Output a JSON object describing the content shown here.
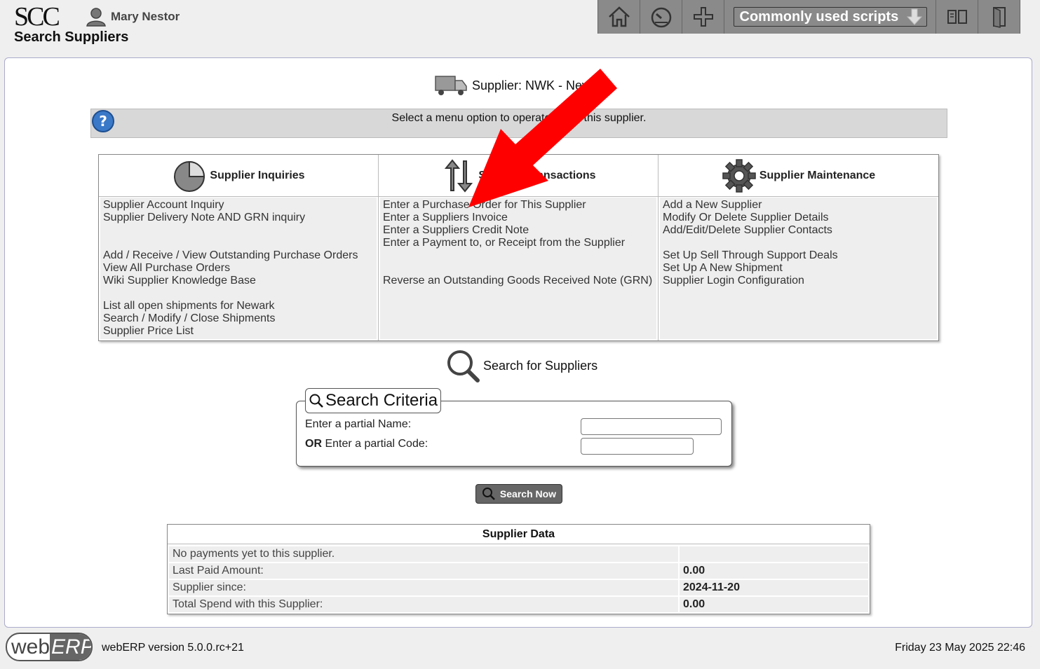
{
  "header": {
    "logo_text": "SCC",
    "user_name": "Mary Nestor",
    "page_title": "Search Suppliers",
    "toolbar": {
      "home_icon": "home-icon",
      "dashboard_icon": "dashboard-icon",
      "add_icon": "plus-icon",
      "scripts_label": "Commonly used scripts",
      "manual_icon": "book-icon",
      "logout_icon": "logout-icon"
    }
  },
  "supplier": {
    "label": "Supplier: NWK - Newark"
  },
  "help": {
    "text": "Select a menu option to operate using this supplier."
  },
  "menu": {
    "inquiries": {
      "title": "Supplier Inquiries",
      "items": [
        "Supplier Account Inquiry",
        "Supplier Delivery Note AND GRN inquiry",
        "Add / Receive / View Outstanding Purchase Orders",
        "View All Purchase Orders",
        "Wiki Supplier Knowledge Base",
        "List all open shipments for Newark",
        "Search / Modify / Close Shipments",
        "Supplier Price List"
      ]
    },
    "transactions": {
      "title": "Supplier Transactions",
      "items": [
        "Enter a Purchase Order for This Supplier",
        "Enter a Suppliers Invoice",
        "Enter a Suppliers Credit Note",
        "Enter a Payment to, or Receipt from the Supplier",
        "Reverse an Outstanding Goods Received Note (GRN)"
      ]
    },
    "maintenance": {
      "title": "Supplier Maintenance",
      "items": [
        "Add a New Supplier",
        "Modify Or Delete Supplier Details",
        "Add/Edit/Delete Supplier Contacts",
        "Set Up Sell Through Support Deals",
        "Set Up A New Shipment",
        "Supplier Login Configuration"
      ]
    }
  },
  "search": {
    "heading": "Search for Suppliers",
    "legend": "Search Criteria",
    "name_label": "Enter a partial Name:",
    "code_label_bold": "OR",
    "code_label": " Enter a partial Code:",
    "name_value": "",
    "code_value": "",
    "button_label": "Search Now"
  },
  "supplier_data": {
    "title": "Supplier Data",
    "rows": [
      {
        "label": "No payments yet to this supplier.",
        "value": ""
      },
      {
        "label": "Last Paid Amount:",
        "value": "0.00"
      },
      {
        "label": "Supplier since:",
        "value": "2024-11-20"
      },
      {
        "label": "Total Spend with this Supplier:",
        "value": "0.00"
      }
    ]
  },
  "footer": {
    "logo_web": "web",
    "logo_erp": "ERP",
    "version": "webERP version 5.0.0.rc+21",
    "datetime": "Friday 23 May 2025 22:46"
  },
  "colors": {
    "annotation_arrow": "#ff0000",
    "toolbar_bg": "#8a8a8a"
  }
}
